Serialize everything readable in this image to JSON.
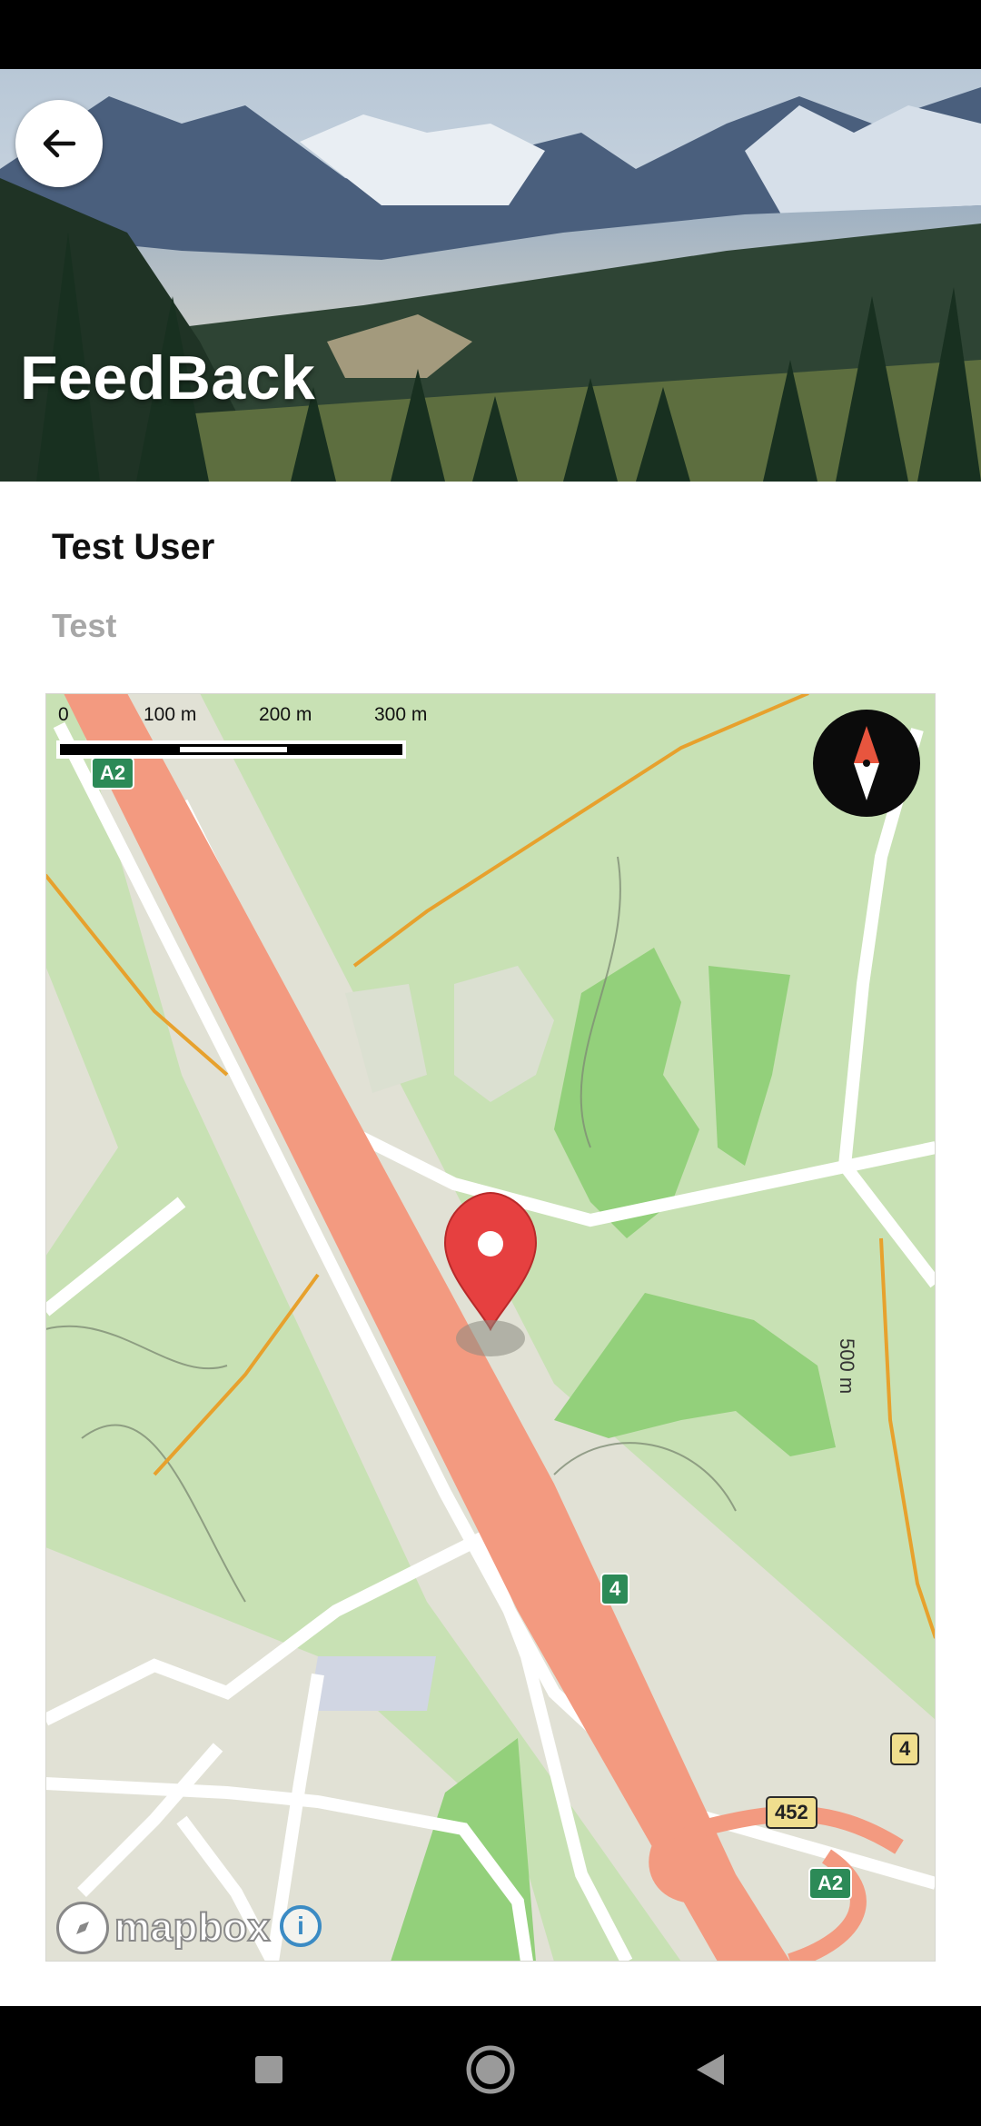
{
  "header": {
    "title": "FeedBack",
    "back_icon": "arrow-left-icon"
  },
  "feedback": {
    "user_name": "Test User",
    "message": "Test"
  },
  "map": {
    "scale_labels": [
      "0",
      "100 m",
      "200 m",
      "300 m"
    ],
    "distance_label": "500 m",
    "road_shields": [
      "A2",
      "4",
      "452",
      "4",
      "A2"
    ],
    "attribution_logo": "mapbox",
    "info_label": "i",
    "compass_icon": "compass-icon",
    "pin_icon": "location-pin-icon"
  },
  "navigation": {
    "recents_icon": "square-icon",
    "home_icon": "circle-icon",
    "back_icon": "triangle-back-icon"
  }
}
